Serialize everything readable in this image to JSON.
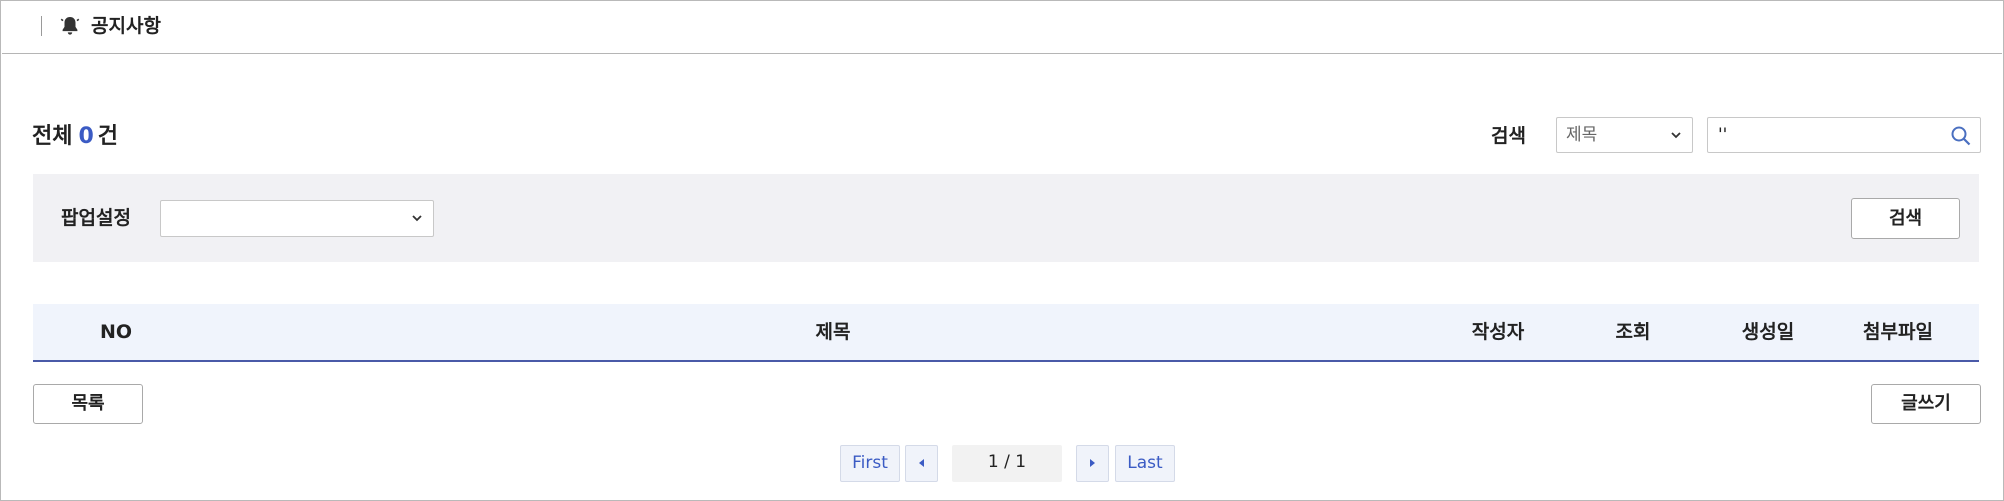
{
  "header": {
    "title": "공지사항",
    "icon": "bell-icon"
  },
  "summary": {
    "prefix": "전체",
    "count": "0",
    "suffix": "건"
  },
  "search": {
    "label": "검색",
    "field_selected": "제목",
    "query_value": "''"
  },
  "filter": {
    "popup_label": "팝업설정",
    "popup_selected": "",
    "search_button": "검색"
  },
  "table": {
    "columns": [
      "NO",
      "제목",
      "작성자",
      "조회",
      "생성일",
      "첨부파일"
    ],
    "rows": []
  },
  "actions": {
    "list_button": "목록",
    "write_button": "글쓰기"
  },
  "pagination": {
    "first": "First",
    "current": "1 / 1",
    "last": "Last"
  },
  "colors": {
    "accent": "#3b5bc4",
    "table_header_bg": "#f0f4fc",
    "panel_bg": "#f1f1f4"
  }
}
